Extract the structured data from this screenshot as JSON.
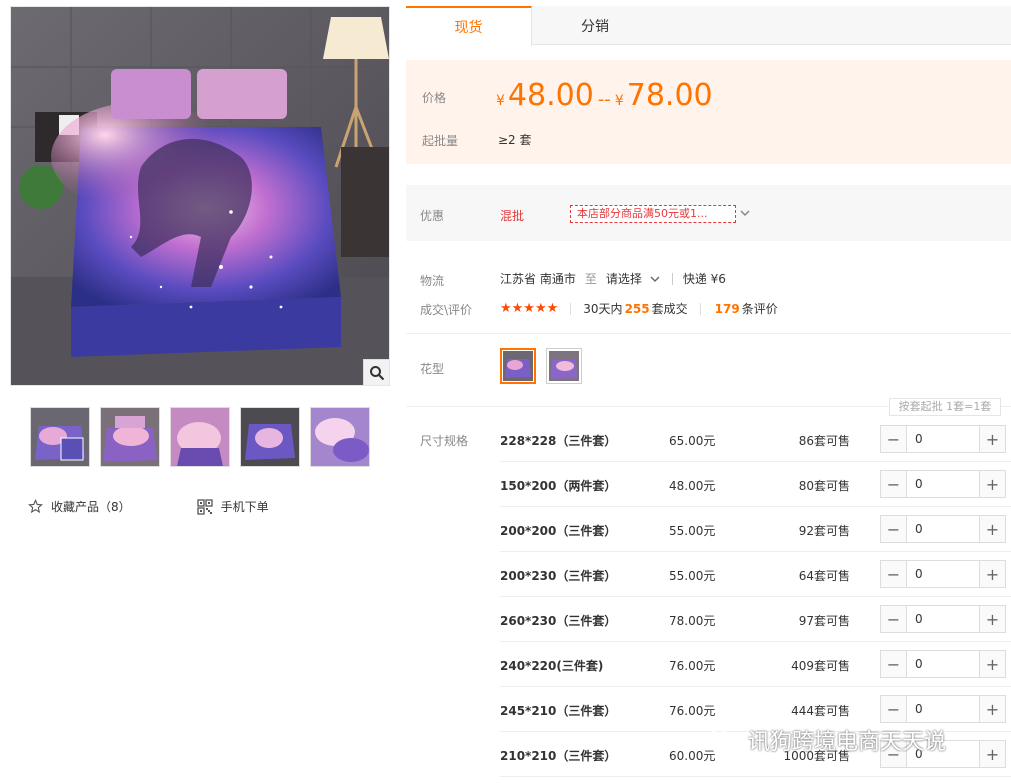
{
  "tabs": [
    {
      "label": "现货"
    },
    {
      "label": "分销"
    }
  ],
  "price": {
    "label": "价格",
    "currency": "¥",
    "low": "48.00",
    "separator": "--",
    "high": "78.00",
    "moq_label": "起批量",
    "moq_value": "≥2 套"
  },
  "promo": {
    "label": "优惠",
    "type": "混批",
    "tag_text": "本店部分商品满50元或1...",
    "arrow": "chevron-down-icon"
  },
  "logistics": {
    "label": "物流",
    "from": "江苏省 南通市",
    "to_word": "至",
    "destination": "请选择",
    "express": "快递 ¥6"
  },
  "deals": {
    "label": "成交\\评价",
    "stars": "★★★★★",
    "rating": 5,
    "prefix": "30天内",
    "count": "255",
    "count_suffix": "套成交",
    "reviews": "179",
    "reviews_suffix": "条评价"
  },
  "pattern": {
    "label": "花型"
  },
  "batch_note": "按套起批 1套=1套",
  "sku_label": "尺寸规格",
  "skus": [
    {
      "name": "228*228（三件套）",
      "price": "65.00元",
      "stock": "86套可售",
      "qty": "0"
    },
    {
      "name": "150*200（两件套）",
      "price": "48.00元",
      "stock": "80套可售",
      "qty": "0"
    },
    {
      "name": "200*200（三件套）",
      "price": "55.00元",
      "stock": "92套可售",
      "qty": "0"
    },
    {
      "name": "200*230（三件套）",
      "price": "55.00元",
      "stock": "64套可售",
      "qty": "0"
    },
    {
      "name": "260*230（三件套）",
      "price": "78.00元",
      "stock": "97套可售",
      "qty": "0"
    },
    {
      "name": "240*220(三件套)",
      "price": "76.00元",
      "stock": "409套可售",
      "qty": "0"
    },
    {
      "name": "245*210（三件套）",
      "price": "76.00元",
      "stock": "444套可售",
      "qty": "0"
    },
    {
      "name": "210*210（三件套）",
      "price": "60.00元",
      "stock": "1000套可售",
      "qty": "0"
    }
  ],
  "stepper": {
    "minus": "−",
    "plus": "+"
  },
  "gallery_actions": {
    "favorite": "收藏产品（8）",
    "mobile": "手机下单"
  },
  "watermark": "讯狗跨境电商天天说",
  "colors": {
    "accent": "#ff7300",
    "promo_red": "#e4393c",
    "price_bg": "#fff3ec"
  }
}
